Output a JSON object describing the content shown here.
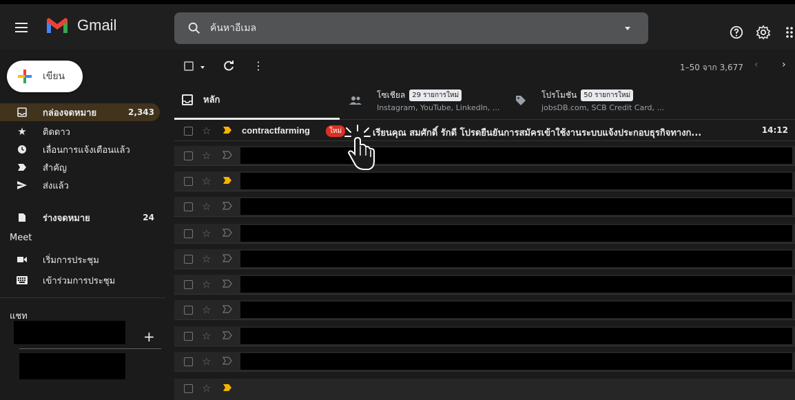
{
  "app": {
    "name": "Gmail"
  },
  "search": {
    "placeholder": "ค้นหาอีเมล"
  },
  "compose": {
    "label": "เขียน"
  },
  "nav": [
    {
      "label": "กล่องจดหมาย",
      "count": "2,343",
      "icon": "inbox-icon",
      "active": true
    },
    {
      "label": "ติดดาว",
      "count": "",
      "icon": "star-icon"
    },
    {
      "label": "เลื่อนการแจ้งเตือนแล้ว",
      "count": "",
      "icon": "clock-icon"
    },
    {
      "label": "สำคัญ",
      "count": "",
      "icon": "important-icon"
    },
    {
      "label": "ส่งแล้ว",
      "count": "",
      "icon": "send-icon"
    },
    {
      "label": "ร่างจดหมาย",
      "count": "24",
      "icon": "draft-icon",
      "bold": true
    }
  ],
  "meet": {
    "title": "Meet",
    "items": [
      {
        "label": "เริ่มการประชุม",
        "icon": "video-icon"
      },
      {
        "label": "เข้าร่วมการประชุม",
        "icon": "keyboard-icon"
      }
    ]
  },
  "chat": {
    "title": "แชท",
    "plus": "+"
  },
  "toolbar": {
    "pagination": "1–50 จาก 3,677",
    "prev": "‹",
    "next": "›",
    "more": "⋮"
  },
  "tabs": {
    "primary": {
      "label": "หลัก"
    },
    "social": {
      "label": "โซเชียล",
      "badge": "29 รายการใหม่",
      "sub": "Instagram, YouTube, LinkedIn, ..."
    },
    "promotions": {
      "label": "โปรโมชัน",
      "badge": "50 รายการใหม่",
      "sub": "jobsDB.com, SCB Credit Card, ..."
    }
  },
  "emails": [
    {
      "sender": "contractfarming",
      "badge": "ใหม่",
      "subject": "เรียนคุณ สมศักดิ์ รักดี โปรดยืนยันการสมัครเข้าใช้งานระบบแจ้งประกอบธุรกิจทางก...",
      "time": "14:12",
      "important": true,
      "redacted": false
    },
    {
      "important": false,
      "redacted": true
    },
    {
      "important": true,
      "redacted": true
    },
    {
      "important": false,
      "redacted": true
    },
    {
      "important": false,
      "redacted": true
    },
    {
      "important": false,
      "redacted": true
    },
    {
      "important": false,
      "redacted": true
    },
    {
      "important": false,
      "redacted": true
    },
    {
      "important": false,
      "redacted": true
    },
    {
      "important": false,
      "redacted": true
    },
    {
      "important": true,
      "redacted": true
    }
  ],
  "colors": {
    "accent_important": "#f4b400",
    "new_badge": "#d93025",
    "active_nav": "#41331c"
  }
}
